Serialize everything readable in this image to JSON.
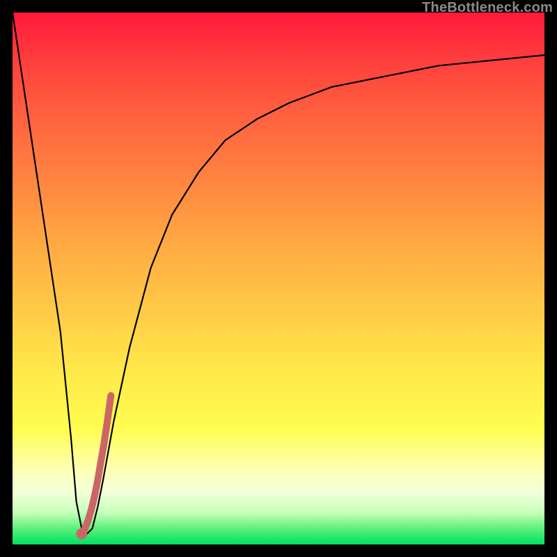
{
  "watermark": "TheBottleneck.com",
  "chart_data": {
    "type": "line",
    "title": "",
    "xlabel": "",
    "ylabel": "",
    "xlim": [
      0,
      100
    ],
    "ylim": [
      0,
      100
    ],
    "grid": false,
    "legend": false,
    "series": [
      {
        "name": "main-curve",
        "color": "#000000",
        "x": [
          0,
          3,
          6,
          9,
          11,
          12,
          13,
          14,
          15,
          16,
          17,
          19,
          22,
          26,
          30,
          35,
          40,
          46,
          52,
          60,
          70,
          80,
          90,
          100
        ],
        "y": [
          100,
          80,
          60,
          40,
          20,
          8,
          3,
          2,
          3,
          7,
          12,
          23,
          37,
          52,
          62,
          70,
          76,
          80,
          83,
          86,
          88,
          90,
          91,
          92
        ]
      },
      {
        "name": "highlight-segment",
        "color": "#cc6666",
        "x": [
          13.0,
          13.6,
          14.2,
          14.8,
          15.4,
          16.0,
          16.6,
          17.2,
          17.8,
          18.5
        ],
        "y": [
          2.0,
          3.0,
          4.5,
          6.5,
          9.0,
          12.0,
          15.5,
          19.0,
          23.0,
          28.0
        ]
      }
    ],
    "annotations": []
  }
}
